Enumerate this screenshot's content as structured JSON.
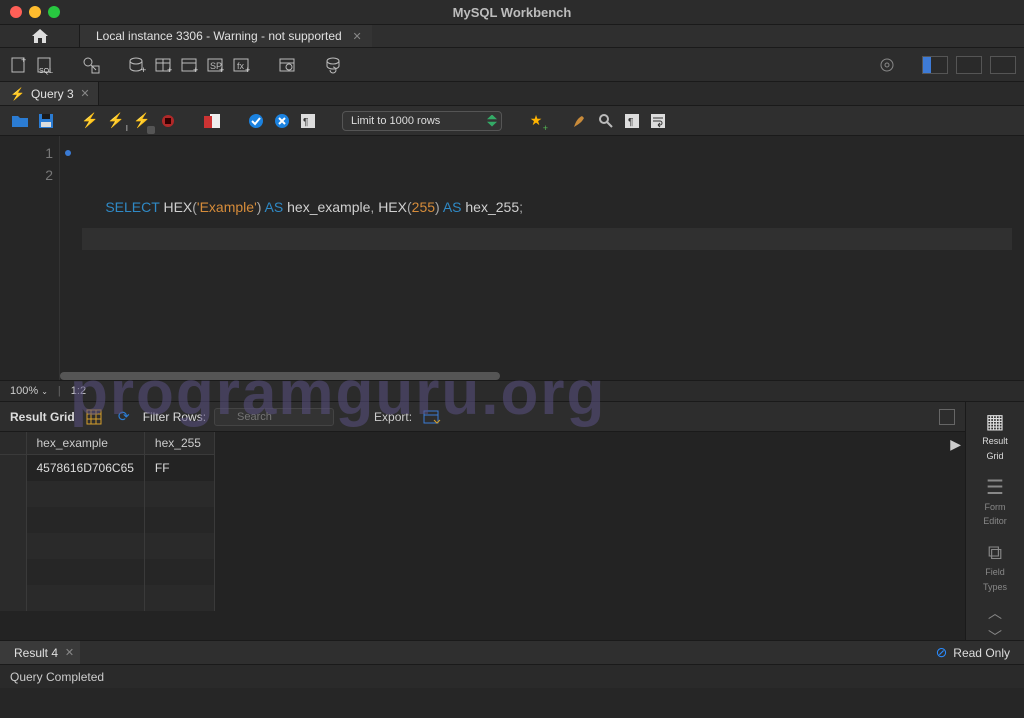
{
  "title": "MySQL Workbench",
  "connection_tab": "Local instance 3306 - Warning - not supported",
  "query_tab": "Query 3",
  "sql_toolbar": {
    "limit_label": "Limit to 1000 rows"
  },
  "editor": {
    "lines": [
      "1",
      "2"
    ],
    "code": {
      "kw_select": "SELECT",
      "fn_hex1": "HEX",
      "paren_o": "(",
      "str": "'Example'",
      "paren_c": ")",
      "kw_as1": "AS",
      "alias1": "hex_example",
      "comma": ",",
      "fn_hex2": "HEX",
      "num": "255",
      "kw_as2": "AS",
      "alias2": "hex_255",
      "semi": ";"
    }
  },
  "editor_footer": {
    "zoom": "100%",
    "pos": "1:2"
  },
  "watermark": "programguru.org",
  "result_bar": {
    "label": "Result Grid",
    "filter_label": "Filter Rows:",
    "filter_placeholder": "Search",
    "export_label": "Export:"
  },
  "columns": [
    "hex_example",
    "hex_255"
  ],
  "rows": [
    {
      "c0": "4578616D706C65",
      "c1": "FF"
    }
  ],
  "side_panel": {
    "result_grid_l1": "Result",
    "result_grid_l2": "Grid",
    "form_l1": "Form",
    "form_l2": "Editor",
    "field_l1": "Field",
    "field_l2": "Types"
  },
  "result_tab": "Result 4",
  "readonly": "Read Only",
  "status": "Query Completed"
}
